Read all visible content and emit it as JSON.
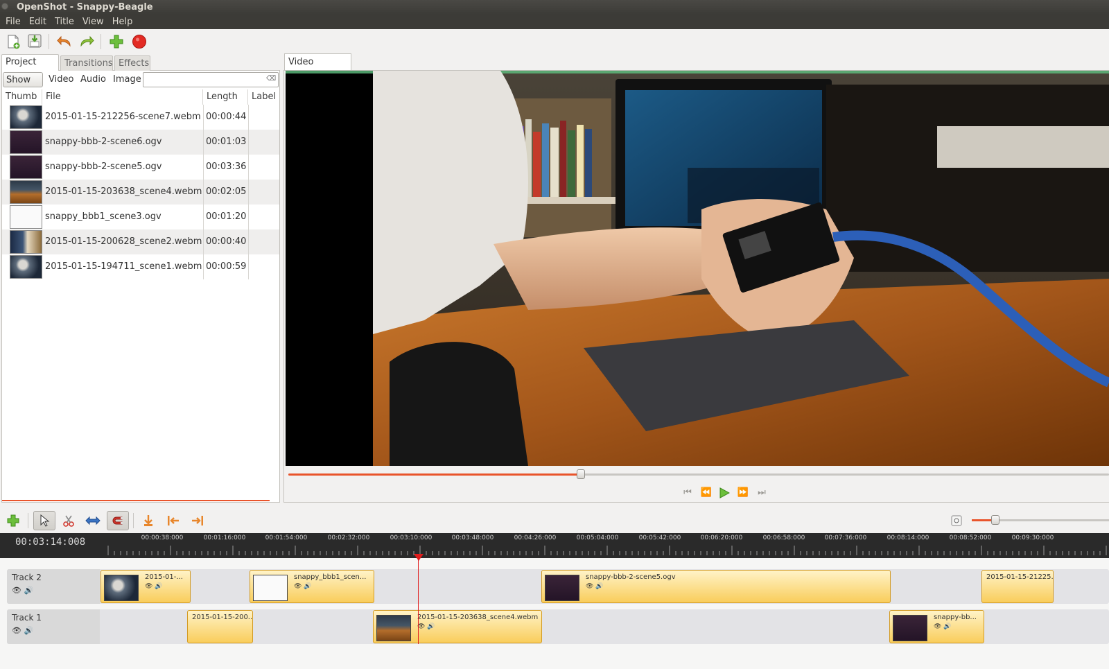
{
  "window": {
    "title": "OpenShot - Snappy-Beagle"
  },
  "menu": [
    "File",
    "Edit",
    "Title",
    "View",
    "Help"
  ],
  "colors": {
    "accent": "#e9542b",
    "clip": "#f9cd5b",
    "playhead": "#e01b1b",
    "ruler_bg": "#2a2a2a"
  },
  "left_tabs": [
    "Project Files",
    "Transitions",
    "Effects"
  ],
  "filters": [
    "Show All",
    "Video",
    "Audio",
    "Image"
  ],
  "search": {
    "value": "",
    "placeholder": ""
  },
  "columns": [
    "Thumb",
    "File",
    "Length",
    "Label"
  ],
  "files": [
    {
      "name": "2015-01-15-212256-scene7.webm",
      "length": "00:00:44",
      "thumb": "room"
    },
    {
      "name": "snappy-bbb-2-scene6.ogv",
      "length": "00:01:03",
      "thumb": "dark"
    },
    {
      "name": "snappy-bbb-2-scene5.ogv",
      "length": "00:03:36",
      "thumb": "dark"
    },
    {
      "name": "2015-01-15-203638_scene4.webm",
      "length": "00:02:05",
      "thumb": "desk"
    },
    {
      "name": "snappy_bbb1_scene3.ogv",
      "length": "00:01:20",
      "thumb": "white"
    },
    {
      "name": "2015-01-15-200628_scene2.webm",
      "length": "00:00:40",
      "thumb": "office"
    },
    {
      "name": "2015-01-15-194711_scene1.webm",
      "length": "00:00:59",
      "thumb": "room"
    }
  ],
  "preview": {
    "tab_label": "Video Preview",
    "seek_fraction": 0.356
  },
  "timeline": {
    "timecode": "00:03:14:008",
    "zoom_fraction": 0.17,
    "ruler_labels": [
      "00:00:38:000",
      "00:01:16:000",
      "00:01:54:000",
      "00:02:32:000",
      "00:03:10:000",
      "00:03:48:000",
      "00:04:26:000",
      "00:05:04:000",
      "00:05:42:000",
      "00:06:20:000",
      "00:06:58:000",
      "00:07:36:000",
      "00:08:14:000",
      "00:08:52:000",
      "00:09:30:000"
    ],
    "tracks": [
      {
        "name": "Track 2",
        "clips": [
          "2015-01-...",
          "snappy_bbb1_scen...",
          "snappy-bbb-2-scene5.ogv",
          "2015-01-15-21225..."
        ]
      },
      {
        "name": "Track 1",
        "clips": [
          "2015-01-15-200...",
          "2015-01-15-203638_scene4.webm",
          "snappy-bb..."
        ]
      }
    ]
  }
}
